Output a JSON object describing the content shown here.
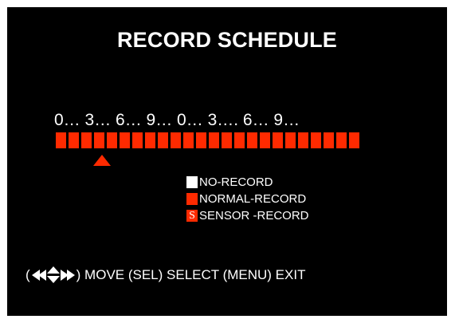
{
  "title": "RECORD SCHEDULE",
  "hour_scale": "0… 3… 6… 9… 0… 3…. 6… 9…",
  "schedule": {
    "slot_modes": [
      "normal",
      "normal",
      "normal",
      "normal",
      "normal",
      "normal",
      "normal",
      "normal",
      "normal",
      "normal",
      "normal",
      "normal",
      "normal",
      "normal",
      "normal",
      "normal",
      "normal",
      "normal",
      "normal",
      "normal",
      "normal",
      "normal",
      "normal",
      "normal"
    ],
    "cursor_slot": 3
  },
  "legend": {
    "no_record": "NO-RECORD",
    "normal_record": "NORMAL-RECORD",
    "sensor_record": "SENSOR -RECORD",
    "sensor_symbol": "S"
  },
  "help": {
    "open_paren": "(",
    "text": ") MOVE (SEL) SELECT (MENU) EXIT"
  },
  "colors": {
    "background": "#000000",
    "normal": "#ff2a00",
    "no_record": "#ffffff",
    "text": "#ffffff"
  },
  "icons": {
    "nav": [
      "rewind-left-icon",
      "up-arrow-icon",
      "down-arrow-icon",
      "forward-right-icon"
    ]
  }
}
